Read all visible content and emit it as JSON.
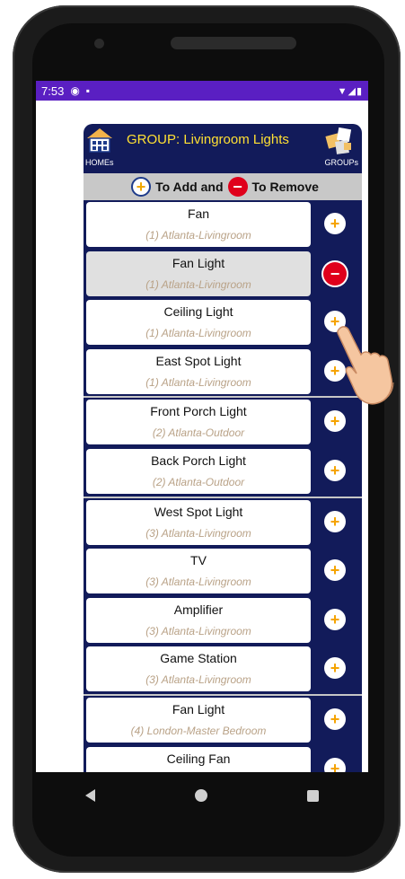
{
  "status_bar": {
    "time": "7:53",
    "icons_left": [
      "circle-p-icon",
      "clipboard-icon"
    ],
    "icons_right": [
      "wifi-icon",
      "signal-icon",
      "battery-icon"
    ]
  },
  "header": {
    "title": "GROUP: Livingroom Lights",
    "homes_label": "HOMEs",
    "groups_label": "GROUPs"
  },
  "instructions": {
    "part1": "To Add and",
    "part2": "To Remove"
  },
  "devices": [
    {
      "name": "Fan",
      "room": "(1) Atlanta-Livingroom",
      "action": "add",
      "selected": false
    },
    {
      "name": "Fan Light",
      "room": "(1) Atlanta-Livingroom",
      "action": "remove",
      "selected": true
    },
    {
      "name": "Ceiling Light",
      "room": "(1) Atlanta-Livingroom",
      "action": "add",
      "selected": false
    },
    {
      "name": "East Spot Light",
      "room": "(1) Atlanta-Livingroom",
      "action": "add",
      "selected": false
    },
    {
      "name": "Front Porch Light",
      "room": "(2) Atlanta-Outdoor",
      "action": "add",
      "selected": false
    },
    {
      "name": "Back Porch Light",
      "room": "(2) Atlanta-Outdoor",
      "action": "add",
      "selected": false
    },
    {
      "name": "West Spot Light",
      "room": "(3) Atlanta-Livingroom",
      "action": "add",
      "selected": false
    },
    {
      "name": "TV",
      "room": "(3) Atlanta-Livingroom",
      "action": "add",
      "selected": false
    },
    {
      "name": "Amplifier",
      "room": "(3) Atlanta-Livingroom",
      "action": "add",
      "selected": false
    },
    {
      "name": "Game Station",
      "room": "(3) Atlanta-Livingroom",
      "action": "add",
      "selected": false
    },
    {
      "name": "Fan Light",
      "room": "(4) London-Master Bedroom",
      "action": "add",
      "selected": false
    },
    {
      "name": "Ceiling Fan",
      "room": "",
      "action": "add",
      "selected": false
    }
  ],
  "colors": {
    "status_bar": "#5a1fc2",
    "app_bg": "#121b5a",
    "title": "#ffe033",
    "add": "#f5a300",
    "remove": "#e0001b",
    "room_text": "#b9a287"
  }
}
